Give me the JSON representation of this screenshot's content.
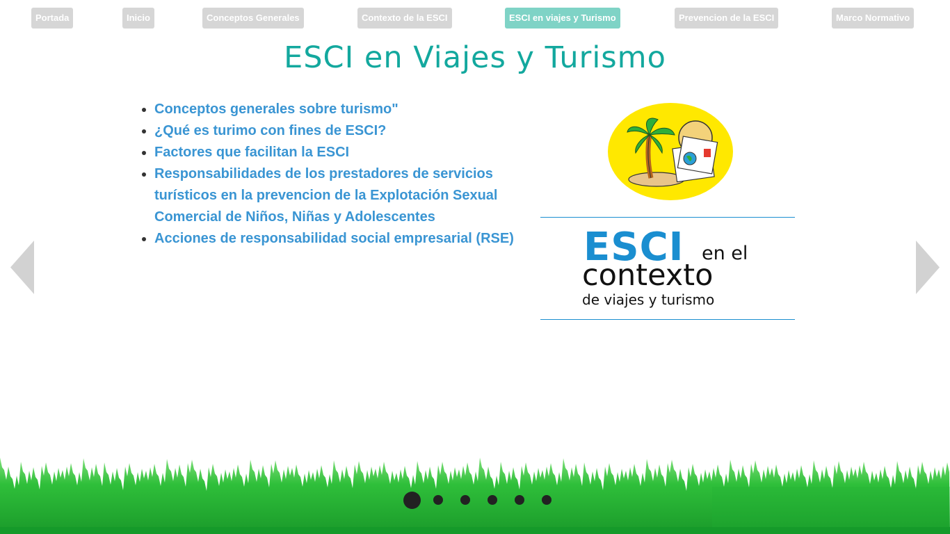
{
  "nav": {
    "items": [
      {
        "label": "Portada"
      },
      {
        "label": "Inicio"
      },
      {
        "label": "Conceptos Generales"
      },
      {
        "label": "Contexto de la ESCI"
      },
      {
        "label": "ESCI en viajes y Turismo"
      },
      {
        "label": "Prevencion de la ESCI"
      },
      {
        "label": "Marco Normativo"
      }
    ],
    "active_index": 4,
    "active_color": "#7fd3c6",
    "inactive_color": "#d6d6d6"
  },
  "page": {
    "title": "ESCI en Viajes y Turismo",
    "title_color": "#13a89e"
  },
  "topics": [
    {
      "text": "Conceptos generales sobre turismo\""
    },
    {
      "text": "¿Qué es turimo con fines de ESCI?"
    },
    {
      "text": "Factores que facilitan la ESCI"
    },
    {
      "text": "Responsabilidades de los prestadores de servicios turísticos en la prevencion de la Explotación Sexual Comercial de Niños, Niñas y Adolescentes"
    },
    {
      "text": "Acciones de responsabilidad social empresarial (RSE)"
    }
  ],
  "logo": {
    "line1": "ESCI",
    "line1_suffix": "en el",
    "line2": "contexto",
    "line3": "de viajes y turismo",
    "accent_color": "#1a8ed0"
  },
  "icons": {
    "illustration": "palm-tree-globe-icon",
    "prev": "arrow-left-icon",
    "next": "arrow-right-icon"
  },
  "pagination": {
    "total": 6,
    "current": 1
  },
  "colors": {
    "link": "#3a95d3",
    "grass": "#2fbf3a"
  }
}
